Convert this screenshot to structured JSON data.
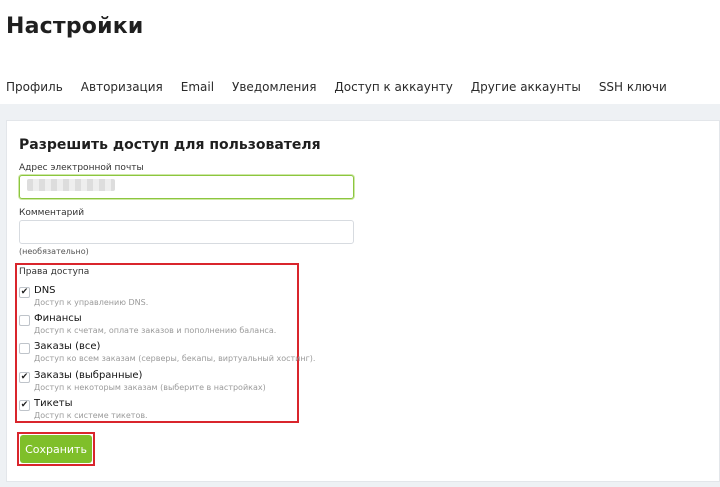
{
  "header": {
    "title": "Настройки"
  },
  "tabs": [
    {
      "label": "Профиль"
    },
    {
      "label": "Авторизация"
    },
    {
      "label": "Email"
    },
    {
      "label": "Уведомления"
    },
    {
      "label": "Доступ к аккаунту"
    },
    {
      "label": "Другие аккаунты"
    },
    {
      "label": "SSH ключи"
    }
  ],
  "form": {
    "title": "Разрешить доступ для пользователя",
    "email_label": "Адрес электронной почты",
    "email_value": "",
    "comment_label": "Комментарий",
    "comment_value": "",
    "comment_hint": "(необязательно)",
    "permissions_title": "Права доступа",
    "permissions": [
      {
        "name": "DNS",
        "desc": "Доступ к управлению DNS.",
        "checked": true,
        "mark": "✔"
      },
      {
        "name": "Финансы",
        "desc": "Доступ к счетам, оплате заказов и пополнению баланса.",
        "checked": false,
        "mark": ""
      },
      {
        "name": "Заказы (все)",
        "desc": "Доступ ко всем заказам (серверы, бекапы, виртуальный хостинг).",
        "checked": false,
        "mark": ""
      },
      {
        "name": "Заказы (выбранные)",
        "desc": "Доступ к некоторым заказам (выберите в настройках)",
        "checked": true,
        "mark": "✔"
      },
      {
        "name": "Тикеты",
        "desc": "Доступ к системе тикетов.",
        "checked": true,
        "mark": "✔"
      }
    ],
    "save_label": "Сохранить"
  },
  "colors": {
    "accent_green": "#7fbf2a",
    "highlight_red": "#d9252c",
    "focus_green": "#8cc63f"
  }
}
